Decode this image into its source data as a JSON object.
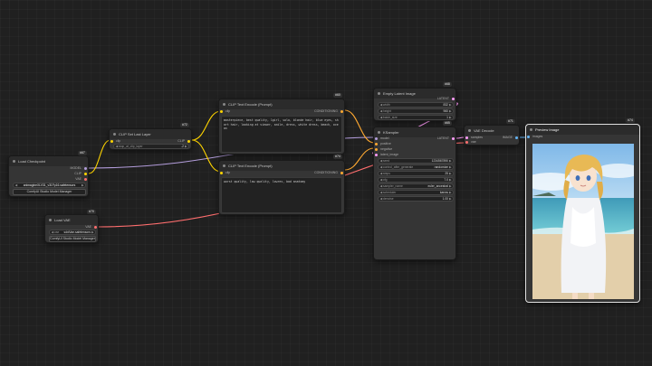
{
  "colors": {
    "model": "#b39ddb",
    "clip": "#ffd500",
    "vae": "#ff6e6e",
    "conditioning": "#ffa931",
    "latent": "#ff9cf9",
    "image": "#64b5f6"
  },
  "nodes": {
    "load_checkpoint": {
      "title": "Load Checkpoint",
      "id": "#67",
      "outputs": [
        "MODEL",
        "CLIP",
        "VAE"
      ],
      "ckpt_value": "animagineXLV31_v31Fp16.safetensors",
      "manager_button": "ComfyUI Studio Model Manager"
    },
    "load_vae": {
      "title": "Load VAE",
      "id": "#70",
      "output": "VAE",
      "vae_label": "vae",
      "vae_value": "sdxlVae.safetensors",
      "manager_button": "ComfyUI Studio Model Manager"
    },
    "clip_last_layer": {
      "title": "CLIP Set Last Layer",
      "id": "#72",
      "input": "clip",
      "output": "CLIP",
      "widget_label": "stop_at_clip_layer",
      "widget_value": "-2"
    },
    "clip_text_positive": {
      "title": "CLIP Text Encode (Prompt)",
      "id": "#60",
      "input": "clip",
      "output": "CONDITIONING",
      "text": "masterpiece, best quality, 1girl, solo, blonde hair, blue eyes, short hair, looking at viewer, smile, dress, white dress, beach, ocean"
    },
    "clip_text_negative": {
      "title": "CLIP Text Encode (Prompt)",
      "id": "#74",
      "input": "clip",
      "output": "CONDITIONING",
      "text": "worst quality, low quality, lowres, bad anatomy"
    },
    "empty_latent": {
      "title": "Empty Latent Image",
      "id": "#68",
      "output": "LATENT",
      "widgets": [
        {
          "label": "width",
          "value": "832"
        },
        {
          "label": "height",
          "value": "960"
        },
        {
          "label": "batch_size",
          "value": "1"
        }
      ]
    },
    "ksampler": {
      "title": "KSampler",
      "id": "#65",
      "inputs": [
        "model",
        "positive",
        "negative",
        "latent_image"
      ],
      "output": "LATENT",
      "widgets": [
        {
          "label": "seed",
          "value": "1234567890"
        },
        {
          "label": "control_after_generate",
          "value": "randomize"
        },
        {
          "label": "steps",
          "value": "25"
        },
        {
          "label": "cfg",
          "value": "7.0"
        },
        {
          "label": "sampler_name",
          "value": "euler_ancestral"
        },
        {
          "label": "scheduler",
          "value": "karras"
        },
        {
          "label": "denoise",
          "value": "1.00"
        }
      ]
    },
    "vae_decode": {
      "title": "VAE Decode",
      "id": "#71",
      "inputs": [
        "samples",
        "vae"
      ],
      "output": "IMAGE"
    },
    "preview_image": {
      "title": "Preview Image",
      "id": "#74",
      "input": "images"
    }
  }
}
